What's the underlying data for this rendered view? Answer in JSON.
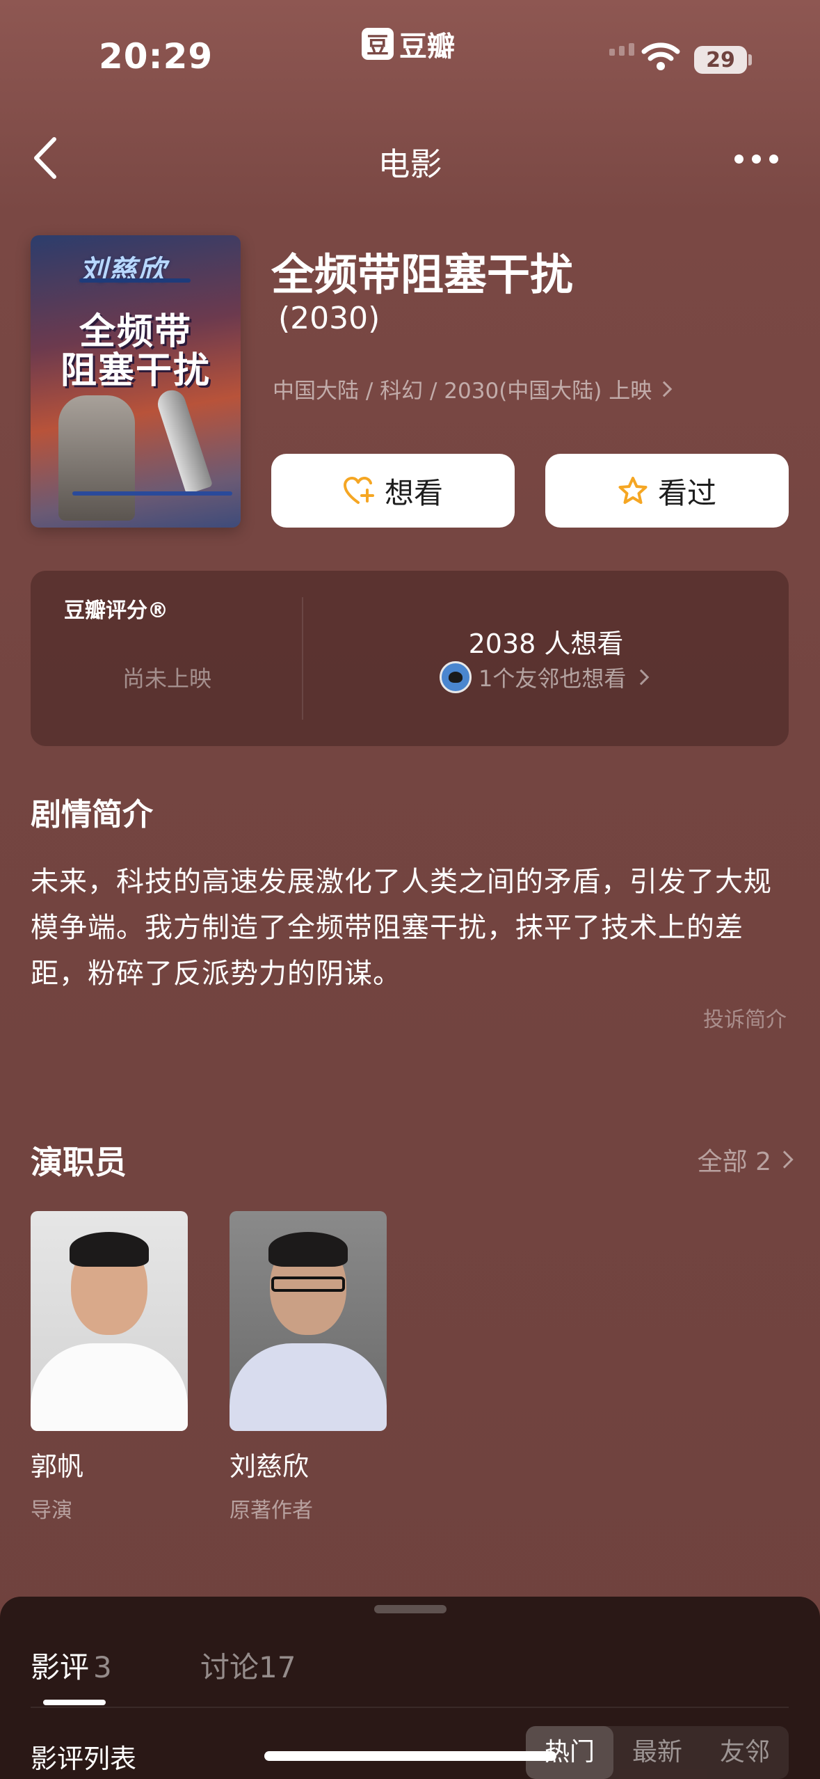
{
  "status_bar": {
    "time": "20:29",
    "app_logo_glyph": "豆",
    "app_name": "豆瓣",
    "battery": "29"
  },
  "nav": {
    "title": "电影"
  },
  "poster": {
    "author": "刘慈欣",
    "title_line1": "全频带",
    "title_line2": "阻塞干扰"
  },
  "movie": {
    "title": "全频带阻塞干扰",
    "year": "(2030)",
    "meta": "中国大陆 / 科幻 / 2030(中国大陆) 上映"
  },
  "actions": {
    "want_label": "想看",
    "seen_label": "看过"
  },
  "rating": {
    "label": "豆瓣评分®",
    "status": "尚未上映",
    "want_count": "2038 人想看",
    "friends_text": "1个友邻也想看"
  },
  "synopsis": {
    "heading": "剧情简介",
    "text": "未来，科技的高速发展激化了人类之间的矛盾，引发了大规模争端。我方制造了全频带阻塞干扰，抹平了技术上的差距，粉碎了反派势力的阴谋。",
    "report_label": "投诉简介"
  },
  "cast": {
    "heading": "演职员",
    "all_label": "全部 2",
    "members": [
      {
        "name": "郭帆",
        "role": "导演"
      },
      {
        "name": "刘慈欣",
        "role": "原著作者"
      }
    ]
  },
  "sheet": {
    "tabs": [
      {
        "label": "影评",
        "count": "3"
      },
      {
        "label": "讨论",
        "count": "17"
      }
    ],
    "list_label": "影评列表",
    "sort_options": [
      "热门",
      "最新",
      "友邻"
    ],
    "sort_selected": "热门"
  },
  "colors": {
    "background": "#744541",
    "accent_star": "#f5a623"
  },
  "icons": {
    "back": "chevron-left-icon",
    "more": "more-dots-icon",
    "want": "heart-plus-icon",
    "seen": "star-icon"
  }
}
